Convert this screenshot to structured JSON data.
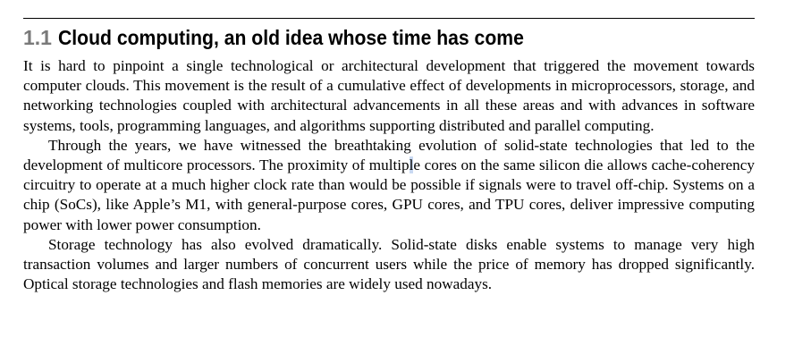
{
  "section": {
    "number": "1.1",
    "title": "Cloud computing, an old idea whose time has come"
  },
  "paragraphs": [
    {
      "text": "It is hard to pinpoint a single technological or architectural development that triggered the movement towards computer clouds. This movement is the result of a cumulative effect of developments in micro­processors, storage, and networking technologies coupled with architectural advancements in all these areas and with advances in software systems, tools, programming languages, and algorithms supporting distributed and parallel computing."
    },
    {
      "before": "Through the years, we have witnessed the breathtaking evolution of solid-state technologies that led to the development of multicore processors. The proximity of multip",
      "highlight": "l",
      "after": "e cores on the same silicon die allows cache-coherency circuitry to operate at a much higher clock rate than would be possible if signals were to travel off-chip. Systems on a chip (SoCs), like Apple’s M1, with general-purpose cores, GPU cores, and TPU cores, deliver impressive computing power with lower power consumption."
    },
    {
      "text": "Storage technology has also evolved dramatically. Solid-state disks enable systems to manage very high transaction volumes and larger numbers of concurrent users while the price of memory has dropped significantly. Optical storage technologies and flash memories are widely used nowadays."
    }
  ],
  "colors": {
    "section_number": "#7a7a7a",
    "selection_highlight": "#c9d9f2"
  }
}
